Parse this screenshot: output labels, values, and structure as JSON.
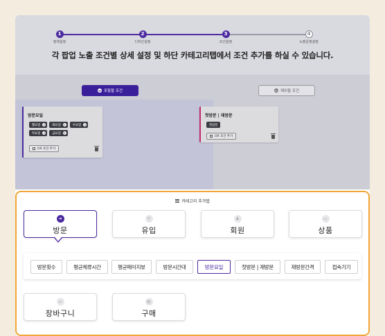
{
  "stepper": {
    "steps": [
      {
        "num": "1",
        "label": "정책설정"
      },
      {
        "num": "2",
        "label": "디자인설정"
      },
      {
        "num": "3",
        "label": "조건설정"
      },
      {
        "num": "4",
        "label": "노출운영설정"
      }
    ]
  },
  "headline": "각 팝업 노출 조건별 상세 설정 및 하단 카테고리탭에서 조건 추가를 하실 수 있습니다.",
  "include_button": "포함할 조건",
  "exclude_button": "제외할 조건",
  "left_condition": {
    "title": "방문요일",
    "chips": [
      "월요일",
      "화요일",
      "수요일",
      "목요일",
      "금요일"
    ],
    "or_label": "OR 조건 추가"
  },
  "right_condition": {
    "title": "첫방문 | 재방문",
    "chips": [
      "첫방문"
    ],
    "or_label": "OR 조건 추가"
  },
  "sheet": {
    "title": "카테고리 추가탭",
    "categories_row1": [
      {
        "label": "방문",
        "icon": "login-icon"
      },
      {
        "label": "유입",
        "icon": "search-icon"
      },
      {
        "label": "회원",
        "icon": "member-icon"
      },
      {
        "label": "상품",
        "icon": "product-icon"
      }
    ],
    "subcategories": [
      "방문횟수",
      "평균체류시간",
      "평균페이지뷰",
      "방문시간대",
      "방문요일",
      "첫방문 | 재방문",
      "재방문간격",
      "접속기기"
    ],
    "categories_row2": [
      {
        "label": "장바구니",
        "icon": "cart-icon"
      },
      {
        "label": "구매",
        "icon": "purchase-icon"
      }
    ]
  },
  "colors": {
    "accent": "#4b2aa0",
    "highlight_border": "#f0a637",
    "exclude_accent": "#c02a6a"
  }
}
